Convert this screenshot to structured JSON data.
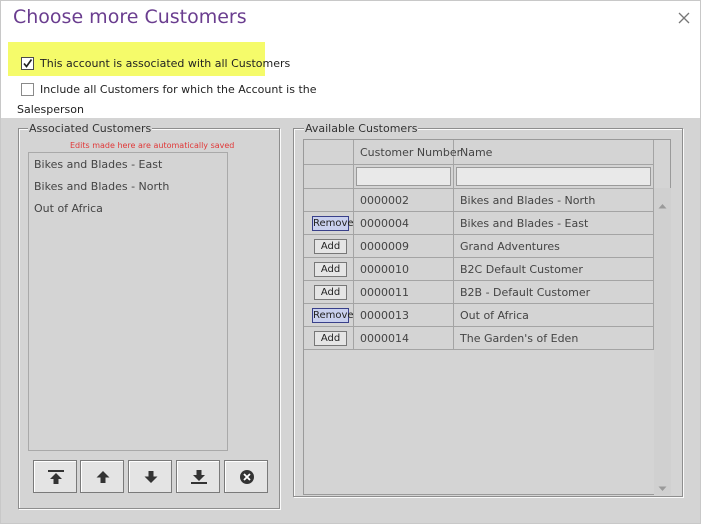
{
  "dialog": {
    "title": "Choose more Customers",
    "close_icon": "close-icon"
  },
  "options": {
    "all_customers": {
      "label": "This account is associated with all Customers",
      "checked": true
    },
    "salesperson": {
      "label_line1": "Include all Customers for which the Account is the",
      "label_line2": "Salesperson",
      "checked": false
    }
  },
  "associated": {
    "legend": "Associated Customers",
    "note": "Edits made here are automatically saved",
    "items": [
      "Bikes and Blades - East",
      "Bikes and Blades - North",
      "Out of Africa"
    ],
    "toolbar_icons": [
      "move-top-icon",
      "move-up-icon",
      "move-down-icon",
      "move-bottom-icon",
      "remove-icon"
    ]
  },
  "available": {
    "legend": "Available Customers",
    "columns": [
      "Customer Number",
      "Name"
    ],
    "rows": [
      {
        "action": "",
        "number": "0000002",
        "name": "Bikes and Blades - North"
      },
      {
        "action": "Remove",
        "number": "0000004",
        "name": "Bikes and Blades - East"
      },
      {
        "action": "Add",
        "number": "0000009",
        "name": "Grand Adventures"
      },
      {
        "action": "Add",
        "number": "0000010",
        "name": "B2C Default Customer"
      },
      {
        "action": "Add",
        "number": "0000011",
        "name": "B2B - Default Customer"
      },
      {
        "action": "Remove",
        "number": "0000013",
        "name": "Out of Africa"
      },
      {
        "action": "Add",
        "number": "0000014",
        "name": "The Garden's of Eden"
      }
    ]
  },
  "colors": {
    "title": "#6a3d8f",
    "highlight": "#f5fb6a",
    "note": "#e03838",
    "remove_button": "#c9d0ee"
  }
}
